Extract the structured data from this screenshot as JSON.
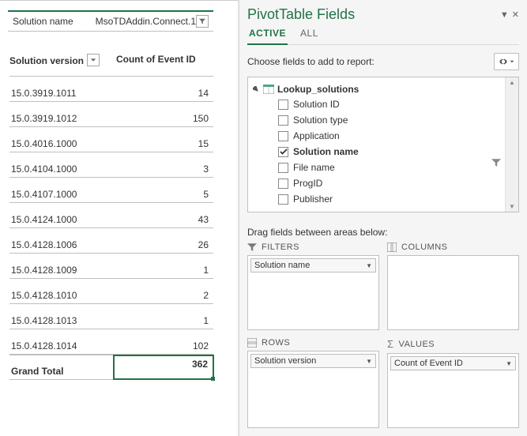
{
  "filter": {
    "label": "Solution name",
    "value": "MsoTDAddin.Connect.1"
  },
  "table": {
    "col1_header": "Solution version",
    "col2_header": "Count of Event ID",
    "rows": [
      {
        "v": "15.0.3919.1011",
        "c": "14"
      },
      {
        "v": "15.0.3919.1012",
        "c": "150"
      },
      {
        "v": "15.0.4016.1000",
        "c": "15"
      },
      {
        "v": "15.0.4104.1000",
        "c": "3"
      },
      {
        "v": "15.0.4107.1000",
        "c": "5"
      },
      {
        "v": "15.0.4124.1000",
        "c": "43"
      },
      {
        "v": "15.0.4128.1006",
        "c": "26"
      },
      {
        "v": "15.0.4128.1009",
        "c": "1"
      },
      {
        "v": "15.0.4128.1010",
        "c": "2"
      },
      {
        "v": "15.0.4128.1013",
        "c": "1"
      },
      {
        "v": "15.0.4128.1014",
        "c": "102"
      }
    ],
    "grand_label": "Grand Total",
    "grand_value": "362"
  },
  "pane": {
    "title": "PivotTable Fields",
    "tabs": {
      "active": "ACTIVE",
      "all": "ALL"
    },
    "choose_label": "Choose fields to add to report:",
    "table_name": "Lookup_solutions",
    "fields": [
      {
        "name": "Solution ID",
        "checked": false
      },
      {
        "name": "Solution type",
        "checked": false
      },
      {
        "name": "Application",
        "checked": false
      },
      {
        "name": "Solution name",
        "checked": true
      },
      {
        "name": "File name",
        "checked": false
      },
      {
        "name": "ProgID",
        "checked": false
      },
      {
        "name": "Publisher",
        "checked": false
      }
    ],
    "drag_label": "Drag fields between areas below:",
    "areas": {
      "filters": {
        "label": "FILTERS",
        "chip": "Solution name"
      },
      "columns": {
        "label": "COLUMNS"
      },
      "rows": {
        "label": "ROWS",
        "chip": "Solution version"
      },
      "values": {
        "label": "VALUES",
        "chip": "Count of Event ID"
      }
    }
  }
}
